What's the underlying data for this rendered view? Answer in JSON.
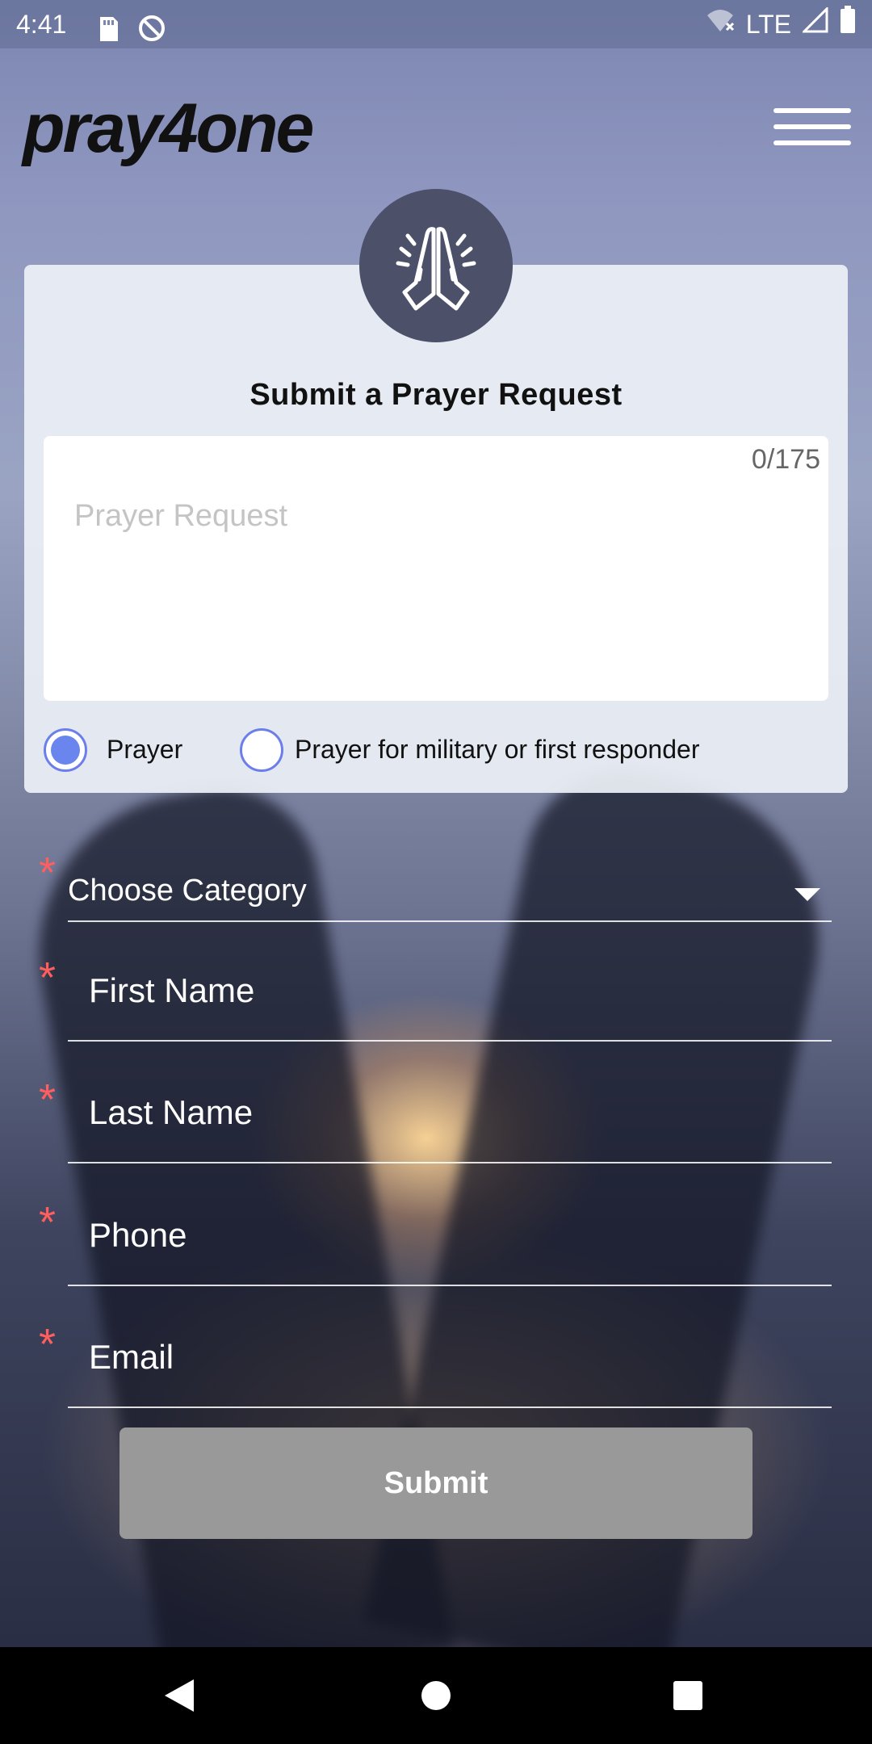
{
  "status_bar": {
    "time": "4:41",
    "network": "LTE",
    "icons": [
      "sd-card-icon",
      "data-saver-icon",
      "wifi-off-icon",
      "signal-icon",
      "battery-icon"
    ]
  },
  "header": {
    "logo_text": "pray4one",
    "menu_icon": "hamburger-menu-icon"
  },
  "card": {
    "badge_icon": "praying-hands-icon",
    "title": "Submit a Prayer Request",
    "request": {
      "placeholder": "Prayer Request",
      "value": "",
      "counter": "0/175"
    },
    "types": [
      {
        "label": "Prayer",
        "selected": true
      },
      {
        "label": "Prayer for military or first responder",
        "selected": false
      }
    ]
  },
  "form": {
    "category": {
      "label": "Choose Category",
      "required": true,
      "icon": "dropdown-caret-icon"
    },
    "first_name": {
      "label": "First Name",
      "required": true
    },
    "last_name": {
      "label": "Last Name",
      "required": true
    },
    "phone": {
      "label": "Phone",
      "required": true
    },
    "email": {
      "label": "Email",
      "required": true
    },
    "required_marker": "*"
  },
  "submit_label": "Submit",
  "colors": {
    "accent": "#6b85ee",
    "required": "#ff5e5e",
    "badge_bg": "#4c5069",
    "submit_bg": "#999999"
  },
  "nav": {
    "back": "back-icon",
    "home": "home-icon",
    "recents": "recents-icon"
  }
}
